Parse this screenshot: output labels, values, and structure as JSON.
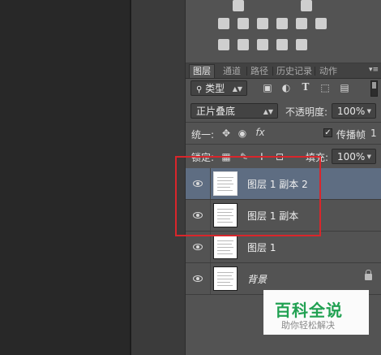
{
  "tabs": [
    {
      "label": "图层",
      "active": true
    },
    {
      "label": "通道"
    },
    {
      "label": "路径"
    },
    {
      "label": "历史记录"
    },
    {
      "label": "动作"
    }
  ],
  "filter": {
    "kind_label": "类型"
  },
  "blend_mode": {
    "value": "正片叠底"
  },
  "opacity": {
    "label": "不透明度:",
    "value": "100%"
  },
  "unify": {
    "label": "统一:",
    "propagate_label": "传播帧",
    "propagate_value": "1",
    "propagate_checked": true
  },
  "lock": {
    "label": "锁定:"
  },
  "fill": {
    "label": "填充:",
    "value": "100%"
  },
  "layers": [
    {
      "name": "图层 1 副本 2",
      "selected": true,
      "visible": true
    },
    {
      "name": "图层 1 副本",
      "selected": false,
      "visible": true
    },
    {
      "name": "图层 1",
      "selected": false,
      "visible": true
    },
    {
      "name": "背景",
      "selected": false,
      "visible": true,
      "locked": true
    }
  ],
  "watermark": {
    "title": "百科全说",
    "subtitle": "助你轻松解决"
  },
  "colors": {
    "selection": "#5e6d82",
    "highlight": "#d9262b",
    "watermark_green": "#21a152"
  }
}
